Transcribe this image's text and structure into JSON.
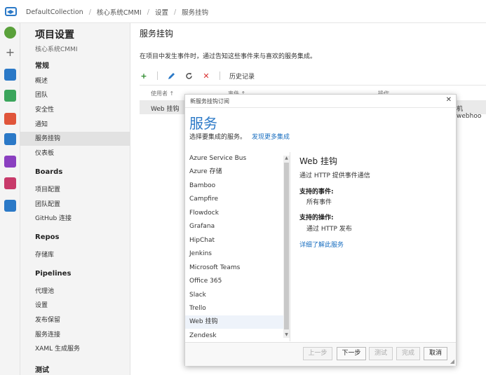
{
  "colors": {
    "accent": "#2b79c7",
    "link": "#1a6fc0",
    "add": "#2e8b2e",
    "delete": "#d93030"
  },
  "breadcrumb": [
    "DefaultCollection",
    "核心系统CMMI",
    "设置",
    "服务挂钩"
  ],
  "nav": {
    "title": "项目设置",
    "subtitle": "核心系统CMMI",
    "sections": [
      {
        "label": "常规",
        "items": [
          "概述",
          "团队",
          "安全性",
          "通知",
          "服务挂钩",
          "仪表板"
        ]
      },
      {
        "label": "Boards",
        "items": [
          "项目配置",
          "团队配置",
          "GitHub 连接"
        ]
      },
      {
        "label": "Repos",
        "items": [
          "存储库"
        ]
      },
      {
        "label": "Pipelines",
        "items": [
          "代理池",
          "设置",
          "发布保留",
          "服务连接",
          "XAML 生成服务"
        ]
      },
      {
        "label": "测试",
        "items": []
      }
    ],
    "selected": "服务挂钩"
  },
  "main": {
    "title": "服务挂钩",
    "description": "在项目中发生事件时，通过告知这些事件来与喜欢的服务集成。",
    "toolbar": {
      "history": "历史记录",
      "icons": [
        "add-icon",
        "edit-icon",
        "refresh-icon",
        "delete-icon"
      ]
    },
    "list": {
      "columns": [
        "使用者 ↑",
        "事件 ↑",
        "操作"
      ],
      "rows": [
        {
          "consumer": "Web 挂钩",
          "event": "",
          "action": "机 webhoo"
        }
      ]
    }
  },
  "dialog": {
    "title": "新服务挂钩订阅",
    "heading": "服务",
    "subheading": "选择要集成的服务。",
    "discover_link": "发现更多集成",
    "services": [
      "Azure Service Bus",
      "Azure 存储",
      "Bamboo",
      "Campfire",
      "Flowdock",
      "Grafana",
      "HipChat",
      "Jenkins",
      "Microsoft Teams",
      "Office 365",
      "Slack",
      "Trello",
      "Web 挂钩",
      "Zendesk"
    ],
    "selected_service": "Web 挂钩",
    "detail": {
      "name": "Web 挂钩",
      "description": "通过 HTTP 提供事件通信",
      "events_label": "支持的事件:",
      "events_value": "所有事件",
      "actions_label": "支持的操作:",
      "actions_value": "通过 HTTP 发布",
      "learn_more": "详细了解此服务"
    },
    "buttons": {
      "prev": "上一步",
      "next": "下一步",
      "test": "测试",
      "finish": "完成",
      "cancel": "取消"
    }
  }
}
